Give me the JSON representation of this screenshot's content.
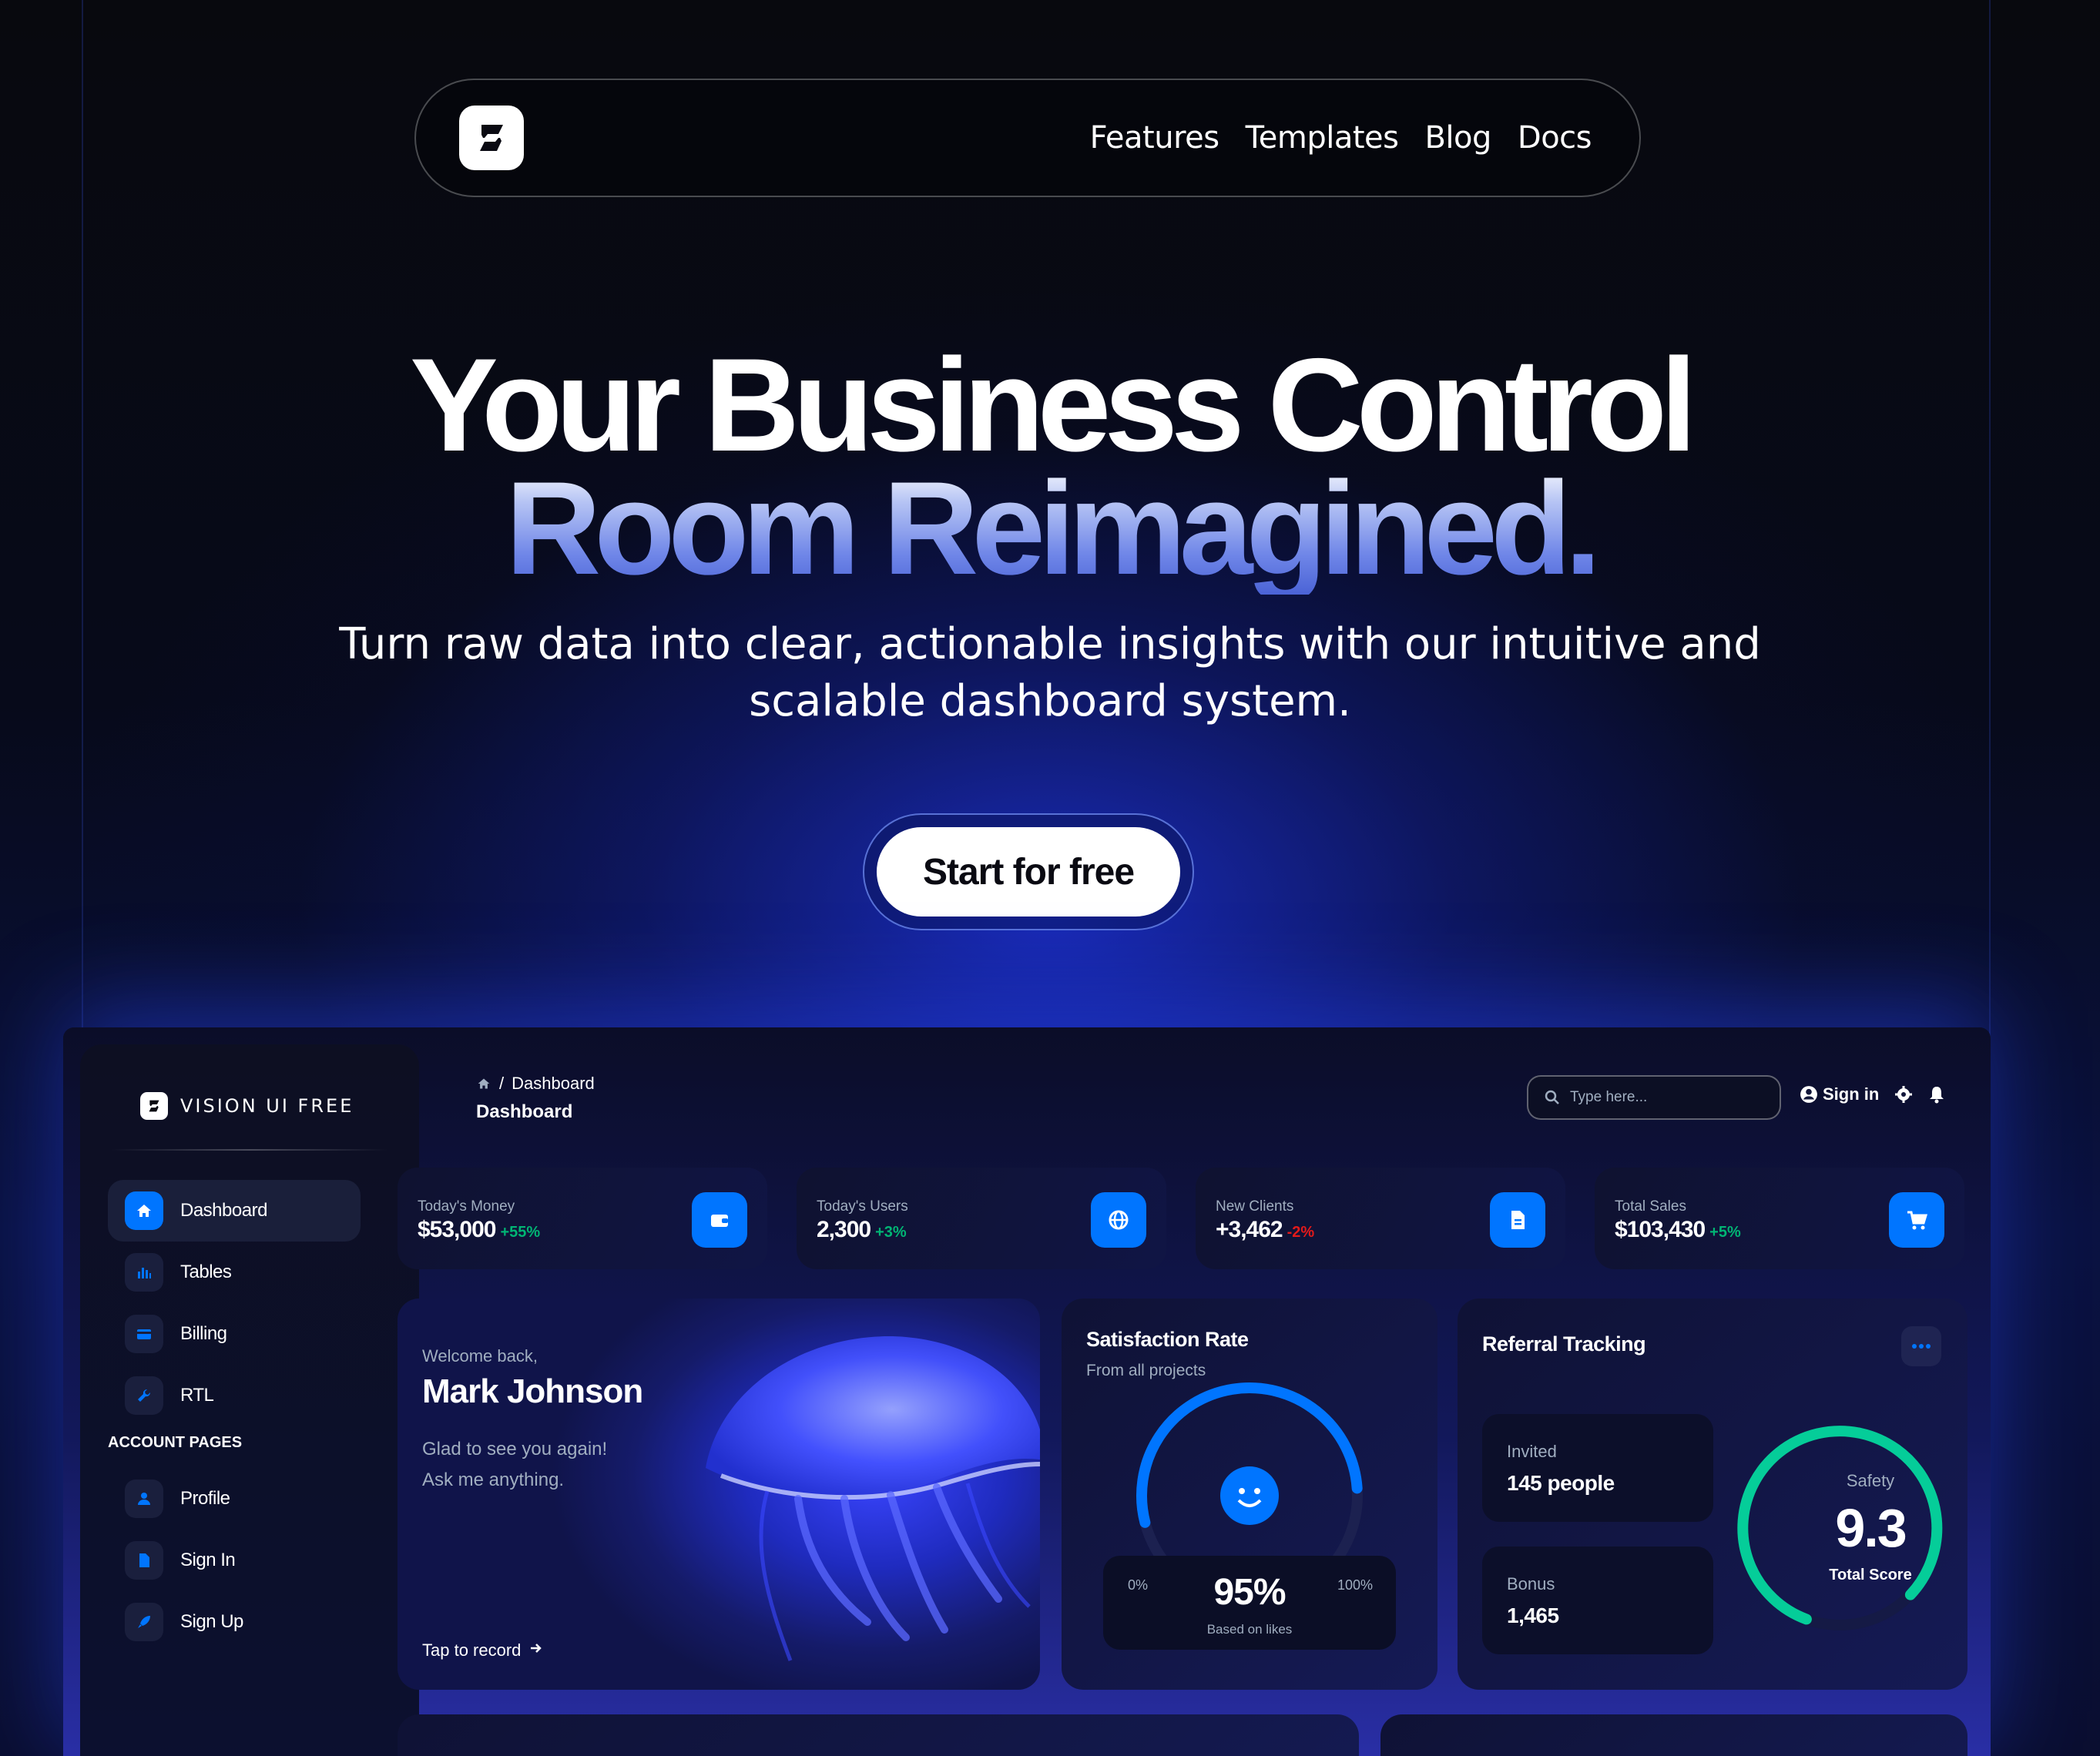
{
  "nav": {
    "links": [
      "Features",
      "Templates",
      "Blog",
      "Docs"
    ]
  },
  "hero": {
    "title_line1": "Your Business Control",
    "title_line2": "Room Reimagined.",
    "subtitle": "Turn raw data into clear, actionable insights with our intuitive and scalable dashboard system.",
    "cta": "Start for free"
  },
  "dashboard": {
    "brand": "VISION UI FREE",
    "sidebar": {
      "items": [
        {
          "label": "Dashboard",
          "icon": "home-icon",
          "active": true
        },
        {
          "label": "Tables",
          "icon": "bar-chart-icon"
        },
        {
          "label": "Billing",
          "icon": "credit-card-icon"
        },
        {
          "label": "RTL",
          "icon": "wrench-icon"
        }
      ],
      "section_title": "ACCOUNT PAGES",
      "account_items": [
        {
          "label": "Profile",
          "icon": "person-icon"
        },
        {
          "label": "Sign In",
          "icon": "document-icon"
        },
        {
          "label": "Sign Up",
          "icon": "rocket-icon"
        }
      ]
    },
    "breadcrumb": {
      "current": "Dashboard"
    },
    "page_title": "Dashboard",
    "search_placeholder": "Type here...",
    "signin_label": "Sign in",
    "stats": [
      {
        "label": "Today's Money",
        "value": "$53,000",
        "change": "+55%",
        "trend": "up",
        "icon": "wallet-icon"
      },
      {
        "label": "Today's Users",
        "value": "2,300",
        "change": "+3%",
        "trend": "up",
        "icon": "globe-icon"
      },
      {
        "label": "New Clients",
        "value": "+3,462",
        "change": "-2%",
        "trend": "down",
        "icon": "document-icon"
      },
      {
        "label": "Total Sales",
        "value": "$103,430",
        "change": "+5%",
        "trend": "up",
        "icon": "cart-icon"
      }
    ],
    "welcome": {
      "greeting": "Welcome back,",
      "name": "Mark Johnson",
      "line1": "Glad to see you again!",
      "line2": "Ask me anything.",
      "action": "Tap to record"
    },
    "satisfaction": {
      "title": "Satisfaction Rate",
      "subtitle": "From all projects",
      "min": "0%",
      "max": "100%",
      "value": "95%",
      "value_fraction": 0.95,
      "note": "Based on likes"
    },
    "referral": {
      "title": "Referral Tracking",
      "invited_label": "Invited",
      "invited_value": "145 people",
      "bonus_label": "Bonus",
      "bonus_value": "1,465",
      "safety_label": "Safety",
      "safety_score": "9.3",
      "score_label": "Total Score"
    },
    "colors": {
      "accent": "#0075ff",
      "positive": "#01b574",
      "negative": "#e31a1a",
      "score_ring": "#05cd99"
    }
  }
}
